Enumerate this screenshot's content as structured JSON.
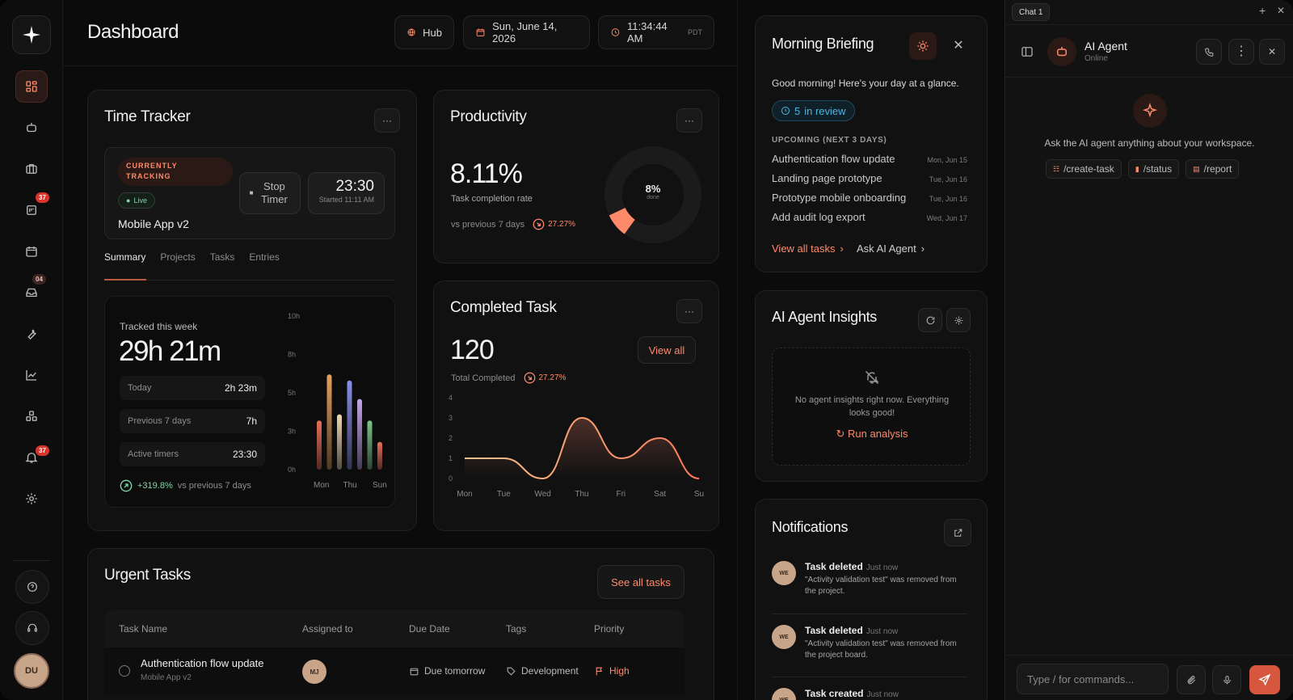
{
  "header": {
    "title": "Dashboard",
    "hub_label": "Hub",
    "date": "Sun, June 14, 2026",
    "time": "11:34:44 AM",
    "tz": "PDT"
  },
  "sidebar": {
    "badges": {
      "tasks": "37",
      "inbox": "04",
      "notifications": "37"
    },
    "user_initials": "DU"
  },
  "time_tracker": {
    "title": "Time Tracker",
    "more": "···",
    "status": "CURRENTLY TRACKING",
    "live": "Live",
    "project": "Mobile App v2",
    "stop_label": "Stop Timer",
    "timer": "23:30",
    "started": "Started 11:11 AM",
    "tabs": [
      "Summary",
      "Projects",
      "Tasks",
      "Entries"
    ],
    "week_label": "Tracked this week",
    "week_total": "29h 21m",
    "stats": [
      {
        "label": "Today",
        "value": "2h 23m"
      },
      {
        "label": "Previous 7 days",
        "value": "7h"
      },
      {
        "label": "Active timers",
        "value": "23:30"
      }
    ],
    "growth": "+319.8%",
    "growth_suffix": "vs previous 7 days",
    "chart_data": {
      "type": "bar",
      "yticks": [
        "10h",
        "8h",
        "5h",
        "3h",
        "0h"
      ],
      "ylim": [
        0,
        10
      ],
      "xlabels": [
        "Mon",
        "Thu",
        "Sun"
      ],
      "series": [
        {
          "color": "#e96f5a",
          "values": [
            3.2
          ]
        },
        {
          "color": "#e8a15a",
          "values": [
            6.2
          ]
        },
        {
          "color": "#f1d9b8",
          "values": [
            3.6
          ]
        },
        {
          "color": "#8a8ee8",
          "values": [
            5.8
          ]
        },
        {
          "color": "#c4a6e8",
          "values": [
            4.6
          ]
        },
        {
          "color": "#7cc58a",
          "values": [
            3.2
          ]
        },
        {
          "color": "#e96f5a",
          "values": [
            1.8
          ]
        }
      ]
    }
  },
  "productivity": {
    "title": "Productivity",
    "value": "8.11%",
    "label": "Task completion rate",
    "compare": "vs previous 7 days",
    "change": "27.27%",
    "ring_value": "8%",
    "ring_label": "done",
    "ring_fraction": 0.08
  },
  "completed": {
    "title": "Completed Task",
    "value": "120",
    "label": "Total Completed",
    "change": "27.27%",
    "view_all": "View all",
    "chart_data": {
      "type": "line",
      "x": [
        "Mon",
        "Tue",
        "Wed",
        "Thu",
        "Fri",
        "Sat",
        "Su"
      ],
      "y": [
        1,
        1,
        0,
        3,
        1,
        2,
        0
      ],
      "yticks": [
        "4",
        "3",
        "2",
        "1",
        "0"
      ],
      "ylim": [
        0,
        4
      ]
    }
  },
  "urgent": {
    "title": "Urgent Tasks",
    "see_all": "See all tasks",
    "columns": [
      "Task Name",
      "Assigned to",
      "Due Date",
      "Tags",
      "Priority"
    ],
    "rows": [
      {
        "name": "Authentication flow update",
        "project": "Mobile App v2",
        "assignee": "MJ",
        "due": "Due tomorrow",
        "tag": "Development",
        "priority": "High"
      }
    ]
  },
  "briefing": {
    "title": "Morning Briefing",
    "greeting": "Good morning! Here's your day at a glance.",
    "review_count": "5",
    "review_label": "in review",
    "upcoming_header": "UPCOMING (NEXT 3 DAYS)",
    "items": [
      {
        "name": "Authentication flow update",
        "date": "Mon, Jun 15"
      },
      {
        "name": "Landing page prototype",
        "date": "Tue, Jun 16"
      },
      {
        "name": "Prototype mobile onboarding",
        "date": "Tue, Jun 16"
      },
      {
        "name": "Add audit log export",
        "date": "Wed, Jun 17"
      }
    ],
    "view_all": "View all tasks",
    "ask_ai": "Ask AI Agent"
  },
  "insights": {
    "title": "AI Agent Insights",
    "empty": "No agent insights right now. Everything looks good!",
    "run": "Run analysis"
  },
  "notifications": {
    "title": "Notifications",
    "items": [
      {
        "initials": "WE",
        "title": "Task deleted",
        "time": "Just now",
        "body": "\"Activity validation test\" was removed from the project."
      },
      {
        "initials": "WE",
        "title": "Task deleted",
        "time": "Just now",
        "body": "\"Activity validation test\" was removed from the project board."
      },
      {
        "initials": "WE",
        "title": "Task created",
        "time": "Just now",
        "body": ""
      }
    ]
  },
  "chat": {
    "tab": "Chat 1",
    "agent_name": "AI Agent",
    "agent_status": "Online",
    "prompt": "Ask the AI agent anything about your workspace.",
    "commands": [
      "/create-task",
      "/status",
      "/report"
    ],
    "input_placeholder": "Type / for commands..."
  },
  "colors": {
    "accent": "#ff8a6a",
    "accent_dark": "#d9342b",
    "live": "#7fd8a6",
    "review": "#4fb6e0"
  }
}
